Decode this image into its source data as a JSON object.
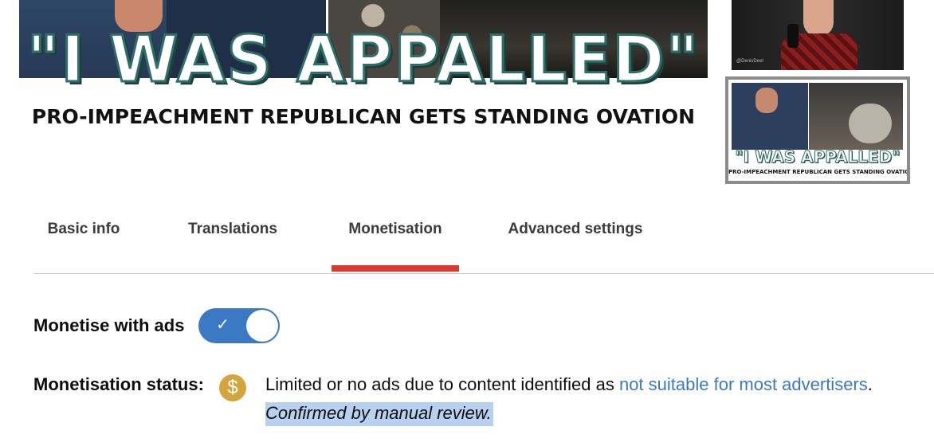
{
  "thumbnail": {
    "headline": "\"I WAS APPALLED\"",
    "subheadline": "PRO-IMPEACHMENT REPUBLICAN GETS STANDING OVATION"
  },
  "side_thumbnails": [
    {
      "watermark": "@DenisDeel"
    },
    {
      "headline": "\"I WAS APPALLED\"",
      "subheadline": "PRO-IMPEACHMENT REPUBLICAN GETS STANDING OVATION"
    }
  ],
  "tabs": [
    {
      "label": "Basic info",
      "active": false
    },
    {
      "label": "Translations",
      "active": false
    },
    {
      "label": "Monetisation",
      "active": true
    },
    {
      "label": "Advanced settings",
      "active": false
    }
  ],
  "monetise": {
    "label": "Monetise with ads",
    "toggle_on": true,
    "toggle_icon": "check-icon"
  },
  "status": {
    "label": "Monetisation status:",
    "icon": "dollar-icon",
    "icon_color": "#d4a53c",
    "text_prefix": "Limited or no ads due to content identified as ",
    "link_text": "not suitable for most advertisers",
    "text_suffix": ".",
    "review_text": "Confirmed by manual review."
  },
  "colors": {
    "accent_blue": "#3b79c4",
    "tab_indicator": "#e4372b"
  }
}
